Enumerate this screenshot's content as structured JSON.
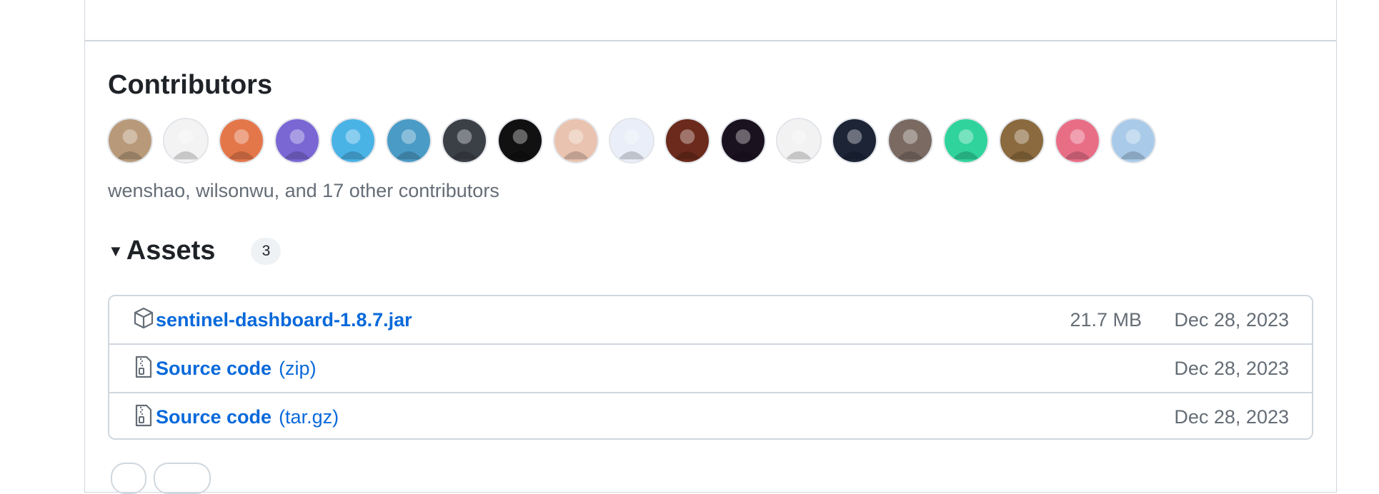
{
  "contributors": {
    "title": "Contributors",
    "summary": "wenshao, wilsonwu, and 17 other contributors",
    "avatars": [
      {
        "label": "contributor-1",
        "color": "#b89a7a"
      },
      {
        "label": "contributor-2",
        "color": "#f3f3f3"
      },
      {
        "label": "contributor-3",
        "color": "#e4774a"
      },
      {
        "label": "contributor-4",
        "color": "#7a67d4"
      },
      {
        "label": "contributor-5",
        "color": "#4ab3e6"
      },
      {
        "label": "contributor-6",
        "color": "#4a9bc6"
      },
      {
        "label": "contributor-7",
        "color": "#3b3f46"
      },
      {
        "label": "contributor-8",
        "color": "#111111"
      },
      {
        "label": "contributor-9",
        "color": "#e9c3b0"
      },
      {
        "label": "contributor-10",
        "color": "#e9eef8"
      },
      {
        "label": "contributor-11",
        "color": "#6b2a1c"
      },
      {
        "label": "contributor-12",
        "color": "#1b1220"
      },
      {
        "label": "contributor-13",
        "color": "#f2f2f2"
      },
      {
        "label": "contributor-14",
        "color": "#1c2436"
      },
      {
        "label": "contributor-15",
        "color": "#7a6a62"
      },
      {
        "label": "contributor-16",
        "color": "#2fd39b"
      },
      {
        "label": "contributor-17",
        "color": "#8a6a3e"
      },
      {
        "label": "contributor-18",
        "color": "#e86e86"
      },
      {
        "label": "contributor-19",
        "color": "#a9cbe9"
      }
    ]
  },
  "assets": {
    "title": "Assets",
    "count": "3",
    "rows": [
      {
        "name": "sentinel-dashboard-1.8.7.jar",
        "suffix": "",
        "size": "21.7 MB",
        "date": "Dec 28, 2023",
        "icon": "package-icon"
      },
      {
        "name": "Source code",
        "suffix": "(zip)",
        "size": "",
        "date": "Dec 28, 2023",
        "icon": "file-zip-icon"
      },
      {
        "name": "Source code",
        "suffix": "(tar.gz)",
        "size": "",
        "date": "Dec 28, 2023",
        "icon": "file-zip-icon"
      }
    ]
  }
}
